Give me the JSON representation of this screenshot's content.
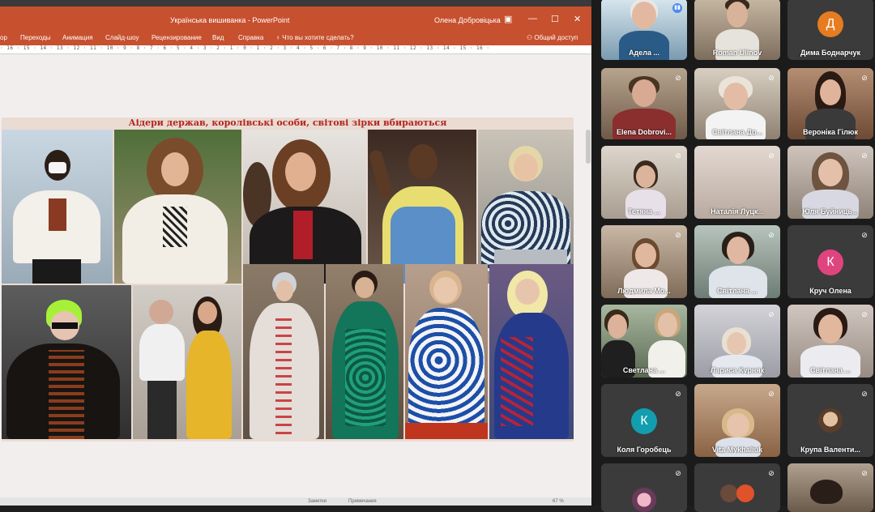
{
  "ppt": {
    "window_title": "Українська вишиванка - PowerPoint",
    "user_name": "Олена Добровіцька",
    "ribbon": [
      "ор",
      "Переходы",
      "Анимация",
      "Слайд-шоу",
      "Рецензирование",
      "Вид",
      "Справка",
      "Что вы хотите сделать?",
      "Общий доступ"
    ],
    "ruler": "· 16 · 15 · 14 · 13 · 12 · 11 · 10 · 9 · 8 · 7 · 6 · 5 · 4 · 3 · 2 · 1 · 0 · 1 · 2 · 3 · 4 · 5 · 6 · 7 · 8 · 9 · 10 · 11 · 12 · 13 · 14 · 15 · 16 ·",
    "slide_title": "Аідери держав, королівські особи, світові зірки вбираються",
    "status_left": "Заметки",
    "status_mid": "Примечания",
    "status_right": "67 %"
  },
  "participants": [
    {
      "name": "Адела ..."
    },
    {
      "name": "Roman Ulinov"
    },
    {
      "name": "Дима Боднарчук",
      "initial": "Д",
      "color": "#e57c1f"
    },
    {
      "name": "Elena Dobrovi..."
    },
    {
      "name": "Світлана Др..."
    },
    {
      "name": "Вероніка Гілюк"
    },
    {
      "name": "Тетяна ..."
    },
    {
      "name": "Наталія Луцк..."
    },
    {
      "name": "Юля Буйниць..."
    },
    {
      "name": "Людмила Мо..."
    },
    {
      "name": "Світлана ..."
    },
    {
      "name": "Круч Олена",
      "initial": "К",
      "color": "#e0447f"
    },
    {
      "name": "Светлана ..."
    },
    {
      "name": "Лариса Курняк"
    },
    {
      "name": "Світлана ..."
    },
    {
      "name": "Коля Горобець",
      "initial": "К",
      "color": "#129eaf"
    },
    {
      "name": "Vita Mykhaliuk"
    },
    {
      "name": "Крупа Валенти..."
    },
    {
      "name": ""
    },
    {
      "name": ""
    },
    {
      "name": ""
    }
  ]
}
